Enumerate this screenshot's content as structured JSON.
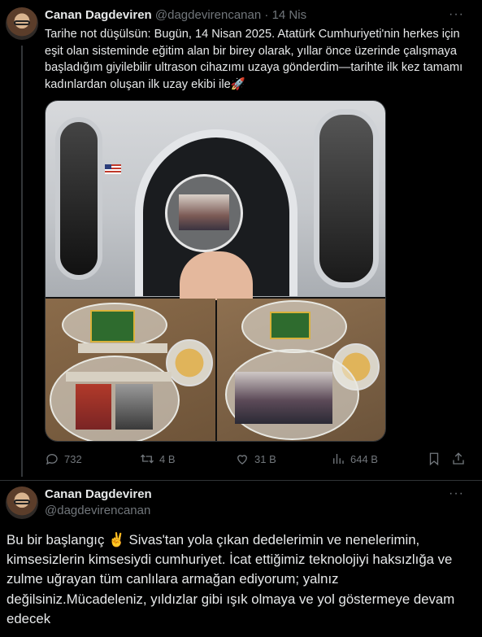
{
  "tweet1": {
    "author_name": "Canan Dagdeviren",
    "author_handle": "@dagdevirencanan",
    "separator": "·",
    "time": "14 Nis",
    "text": "Tarihe not düşülsün: Bugün, 14 Nisan 2025. Atatürk Cumhuriyeti'nin herkes için eşit olan sisteminde eğitim alan bir birey olarak, yıllar önce üzerinde çalışmaya başladığım giyilebilir ultrason cihazımı uzaya gönderdim—tarihte ilk kez tamamı kadınlardan oluşan ilk uzay ekibi ile🚀",
    "more_icon": "more-dots-icon",
    "stats": {
      "replies": "732",
      "retweets": "4 B",
      "likes": "31 B",
      "views": "644 B"
    }
  },
  "tweet2": {
    "author_name": "Canan Dagdeviren",
    "author_handle": "@dagdevirencanan",
    "more_icon": "more-dots-icon",
    "text": "Bu bir başlangıç ✌️ Sivas'tan yola çıkan dedelerimin ve nenelerimin, kimsesizlerin kimsesiydi cumhuriyet. İcat ettiğimiz teknolojiyi haksızlığa ve zulme uğrayan tüm canlılara armağan ediyorum; yalnız değilsiniz.Mücadeleniz, yıldızlar gibi ışık olmaya ve yol göstermeye devam edecek"
  },
  "colors": {
    "background": "#000000",
    "text": "#e7e9ea",
    "secondary_text": "#71767b",
    "border": "#2f3336"
  }
}
